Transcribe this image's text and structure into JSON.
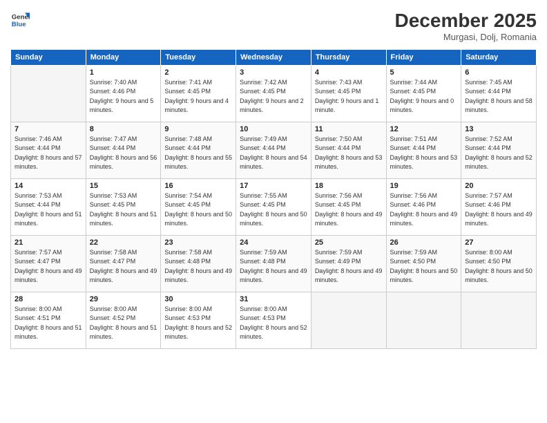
{
  "logo": {
    "line1": "General",
    "line2": "Blue"
  },
  "title": "December 2025",
  "location": "Murgasi, Dolj, Romania",
  "days_of_week": [
    "Sunday",
    "Monday",
    "Tuesday",
    "Wednesday",
    "Thursday",
    "Friday",
    "Saturday"
  ],
  "weeks": [
    [
      {
        "num": "",
        "empty": true
      },
      {
        "num": "1",
        "sunrise": "7:40 AM",
        "sunset": "4:46 PM",
        "daylight": "9 hours and 5 minutes."
      },
      {
        "num": "2",
        "sunrise": "7:41 AM",
        "sunset": "4:45 PM",
        "daylight": "9 hours and 4 minutes."
      },
      {
        "num": "3",
        "sunrise": "7:42 AM",
        "sunset": "4:45 PM",
        "daylight": "9 hours and 2 minutes."
      },
      {
        "num": "4",
        "sunrise": "7:43 AM",
        "sunset": "4:45 PM",
        "daylight": "9 hours and 1 minute."
      },
      {
        "num": "5",
        "sunrise": "7:44 AM",
        "sunset": "4:45 PM",
        "daylight": "9 hours and 0 minutes."
      },
      {
        "num": "6",
        "sunrise": "7:45 AM",
        "sunset": "4:44 PM",
        "daylight": "8 hours and 58 minutes."
      }
    ],
    [
      {
        "num": "7",
        "sunrise": "7:46 AM",
        "sunset": "4:44 PM",
        "daylight": "8 hours and 57 minutes."
      },
      {
        "num": "8",
        "sunrise": "7:47 AM",
        "sunset": "4:44 PM",
        "daylight": "8 hours and 56 minutes."
      },
      {
        "num": "9",
        "sunrise": "7:48 AM",
        "sunset": "4:44 PM",
        "daylight": "8 hours and 55 minutes."
      },
      {
        "num": "10",
        "sunrise": "7:49 AM",
        "sunset": "4:44 PM",
        "daylight": "8 hours and 54 minutes."
      },
      {
        "num": "11",
        "sunrise": "7:50 AM",
        "sunset": "4:44 PM",
        "daylight": "8 hours and 53 minutes."
      },
      {
        "num": "12",
        "sunrise": "7:51 AM",
        "sunset": "4:44 PM",
        "daylight": "8 hours and 53 minutes."
      },
      {
        "num": "13",
        "sunrise": "7:52 AM",
        "sunset": "4:44 PM",
        "daylight": "8 hours and 52 minutes."
      }
    ],
    [
      {
        "num": "14",
        "sunrise": "7:53 AM",
        "sunset": "4:44 PM",
        "daylight": "8 hours and 51 minutes."
      },
      {
        "num": "15",
        "sunrise": "7:53 AM",
        "sunset": "4:45 PM",
        "daylight": "8 hours and 51 minutes."
      },
      {
        "num": "16",
        "sunrise": "7:54 AM",
        "sunset": "4:45 PM",
        "daylight": "8 hours and 50 minutes."
      },
      {
        "num": "17",
        "sunrise": "7:55 AM",
        "sunset": "4:45 PM",
        "daylight": "8 hours and 50 minutes."
      },
      {
        "num": "18",
        "sunrise": "7:56 AM",
        "sunset": "4:45 PM",
        "daylight": "8 hours and 49 minutes."
      },
      {
        "num": "19",
        "sunrise": "7:56 AM",
        "sunset": "4:46 PM",
        "daylight": "8 hours and 49 minutes."
      },
      {
        "num": "20",
        "sunrise": "7:57 AM",
        "sunset": "4:46 PM",
        "daylight": "8 hours and 49 minutes."
      }
    ],
    [
      {
        "num": "21",
        "sunrise": "7:57 AM",
        "sunset": "4:47 PM",
        "daylight": "8 hours and 49 minutes."
      },
      {
        "num": "22",
        "sunrise": "7:58 AM",
        "sunset": "4:47 PM",
        "daylight": "8 hours and 49 minutes."
      },
      {
        "num": "23",
        "sunrise": "7:58 AM",
        "sunset": "4:48 PM",
        "daylight": "8 hours and 49 minutes."
      },
      {
        "num": "24",
        "sunrise": "7:59 AM",
        "sunset": "4:48 PM",
        "daylight": "8 hours and 49 minutes."
      },
      {
        "num": "25",
        "sunrise": "7:59 AM",
        "sunset": "4:49 PM",
        "daylight": "8 hours and 49 minutes."
      },
      {
        "num": "26",
        "sunrise": "7:59 AM",
        "sunset": "4:50 PM",
        "daylight": "8 hours and 50 minutes."
      },
      {
        "num": "27",
        "sunrise": "8:00 AM",
        "sunset": "4:50 PM",
        "daylight": "8 hours and 50 minutes."
      }
    ],
    [
      {
        "num": "28",
        "sunrise": "8:00 AM",
        "sunset": "4:51 PM",
        "daylight": "8 hours and 51 minutes."
      },
      {
        "num": "29",
        "sunrise": "8:00 AM",
        "sunset": "4:52 PM",
        "daylight": "8 hours and 51 minutes."
      },
      {
        "num": "30",
        "sunrise": "8:00 AM",
        "sunset": "4:53 PM",
        "daylight": "8 hours and 52 minutes."
      },
      {
        "num": "31",
        "sunrise": "8:00 AM",
        "sunset": "4:53 PM",
        "daylight": "8 hours and 52 minutes."
      },
      {
        "num": "",
        "empty": true
      },
      {
        "num": "",
        "empty": true
      },
      {
        "num": "",
        "empty": true
      }
    ]
  ]
}
